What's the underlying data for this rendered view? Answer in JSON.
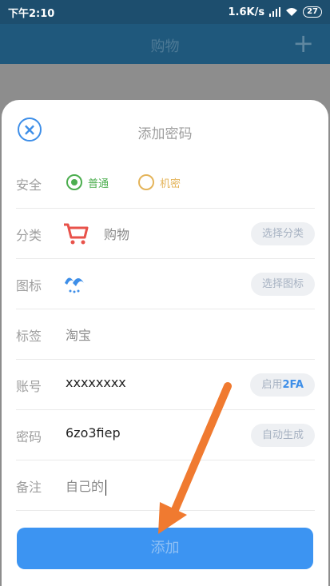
{
  "status": {
    "time": "下午2:10",
    "speed": "1.6K/s",
    "battery": "27"
  },
  "appbar": {
    "title": "购物",
    "add_icon": "plus-icon"
  },
  "sheet": {
    "title": "添加密码",
    "security": {
      "label": "安全",
      "options": [
        "普通",
        "机密"
      ],
      "selected": "普通"
    },
    "category": {
      "label": "分类",
      "value": "购物",
      "button": "选择分类"
    },
    "icon": {
      "label": "图标",
      "button": "选择图标"
    },
    "tag": {
      "label": "标签",
      "value": "淘宝"
    },
    "account": {
      "label": "账号",
      "value": "xxxxxxxx",
      "button_prefix": "启用",
      "button_highlight": "2FA"
    },
    "password": {
      "label": "密码",
      "value": "6zo3fiep",
      "button": "自动生成"
    },
    "note": {
      "label": "备注",
      "value": "自己的"
    },
    "submit": "添加"
  },
  "colors": {
    "accent": "#3c94f2",
    "green": "#4cae4f",
    "orange": "#e4b45a",
    "arrow": "#f07a30"
  }
}
